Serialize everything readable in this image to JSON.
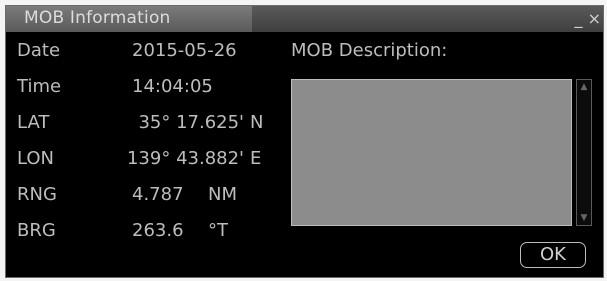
{
  "window": {
    "title": "MOB Information",
    "controls": "_ ×"
  },
  "fields": {
    "date_label": "Date",
    "date_value": "2015-05-26",
    "time_label": "Time",
    "time_value": "14:04:05",
    "lat_label": "LAT",
    "lat_value": "35° 17.625'",
    "lat_hemi": "N",
    "lon_label": "LON",
    "lon_value": "139° 43.882'",
    "lon_hemi": "E",
    "rng_label": "RNG",
    "rng_value": "4.787",
    "rng_unit": "NM",
    "brg_label": "BRG",
    "brg_value": "263.6",
    "brg_unit": "°T"
  },
  "description": {
    "label": "MOB Description:",
    "text": ""
  },
  "buttons": {
    "ok_label": "OK"
  }
}
